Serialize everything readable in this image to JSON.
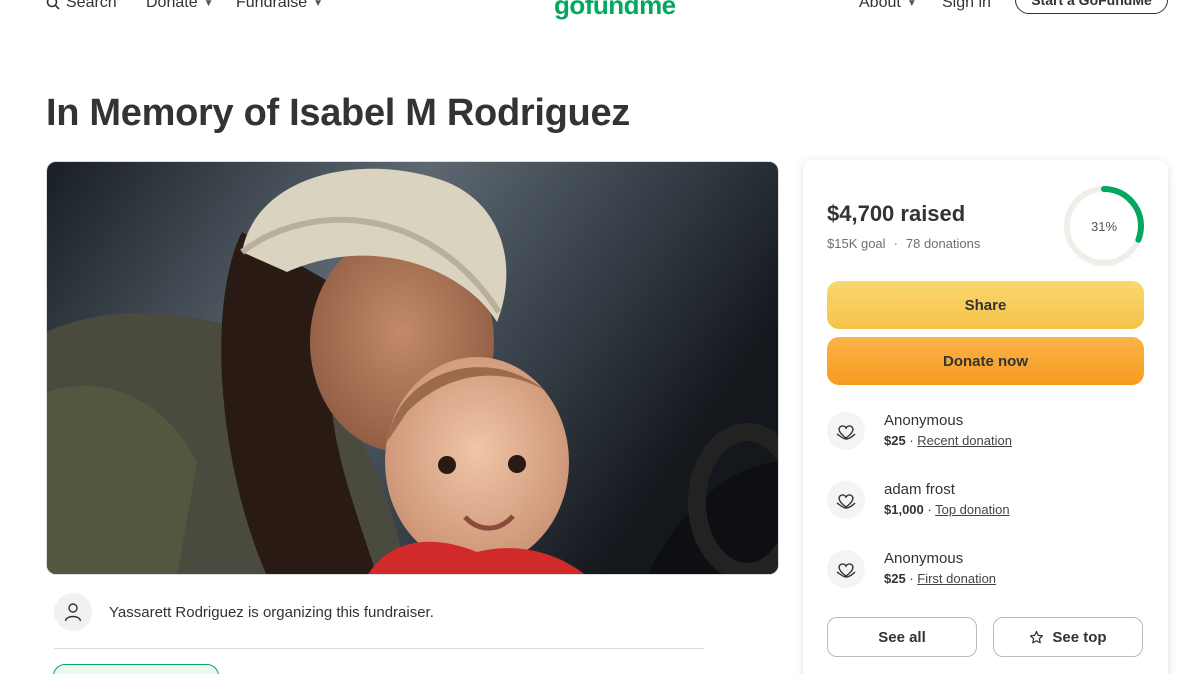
{
  "header": {
    "search_label": "Search",
    "donate_label": "Donate",
    "fundraise_label": "Fundraise",
    "logo_text": "gofundme",
    "about_label": "About",
    "signin_label": "Sign in",
    "start_label": "Start a GoFundMe"
  },
  "page": {
    "title": "In Memory of Isabel M Rodriguez",
    "organizer_text": "Yassarett Rodriguez is organizing this fundraiser."
  },
  "progress": {
    "raised": "$4,700 raised",
    "goal": "$15K goal",
    "separator": "·",
    "donations": "78 donations",
    "percent_label": "31%",
    "percent_value": 0.31
  },
  "actions": {
    "share_label": "Share",
    "donate_label": "Donate now",
    "see_all_label": "See all",
    "see_top_label": "See top"
  },
  "donations": [
    {
      "name": "Anonymous",
      "amount": "$25",
      "separator": " · ",
      "tag": "Recent donation"
    },
    {
      "name": "adam frost",
      "amount": "$1,000",
      "separator": " · ",
      "tag": "Top donation"
    },
    {
      "name": "Anonymous",
      "amount": "$25",
      "separator": " · ",
      "tag": "First donation"
    }
  ],
  "colors": {
    "brand": "#02a95c",
    "share": "#f5c24a",
    "donate": "#f59b1f"
  }
}
